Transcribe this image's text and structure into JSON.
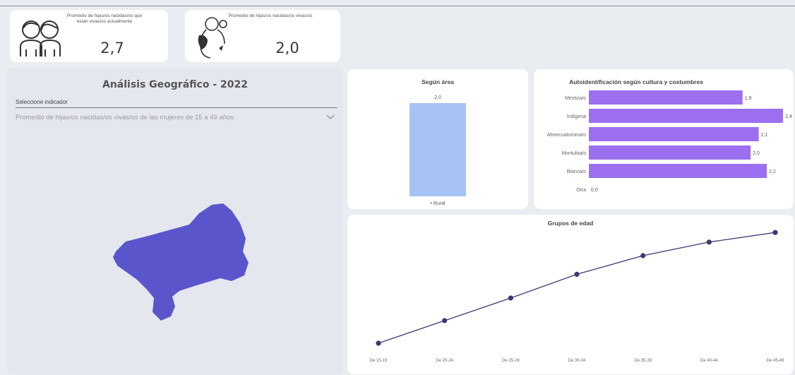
{
  "kpis": [
    {
      "title": "Promedio de hijas/os nacidas/os que están vivas/os actualmente",
      "value": "2,7",
      "icon": "two-children-icon"
    },
    {
      "title": "Promedio de hijas/os nacidas/os vivas/os",
      "value": "2,0",
      "icon": "mother-child-icon"
    }
  ],
  "geo": {
    "title": "Análisis Geográfico - 2022",
    "selector_label": "Seleccione indicador",
    "selector_value": "Promedio de hijas/os nacidas/os vivas/os de las mujeres de 15 a 49 años",
    "map_color": "#5b55cc"
  },
  "chart_data": [
    {
      "type": "bar",
      "title": "Según área",
      "categories": [
        "Rural"
      ],
      "values": [
        2.0
      ],
      "data_labels": [
        "2,0"
      ],
      "legend_label": "Rural",
      "color": "#a7c3f4",
      "ylim": [
        0,
        2.0
      ]
    },
    {
      "type": "bar",
      "orientation": "horizontal",
      "title": "Autoidentificación según cultura y costumbres",
      "categories": [
        "Mestiza/o",
        "Indígena",
        "Afroecuatoriana/o",
        "Montubia/o",
        "Blanca/o",
        "Otra"
      ],
      "values": [
        1.9,
        2.4,
        2.1,
        2.0,
        2.2,
        0.0
      ],
      "data_labels": [
        "1,9",
        "2,4",
        "2,1",
        "2,0",
        "2,2",
        "0,0"
      ],
      "color": "#9b6ff0",
      "xlim": [
        0,
        2.4
      ]
    },
    {
      "type": "line",
      "title": "Grupos de edad",
      "categories": [
        "De 15-19",
        "De 20-24",
        "De 25-29",
        "De 30-34",
        "De 35-39",
        "De 40-44",
        "De 45-49"
      ],
      "values": [
        0.5,
        0.9,
        1.3,
        1.72,
        2.05,
        2.29,
        2.46
      ],
      "color": "#3b3a6e"
    }
  ]
}
